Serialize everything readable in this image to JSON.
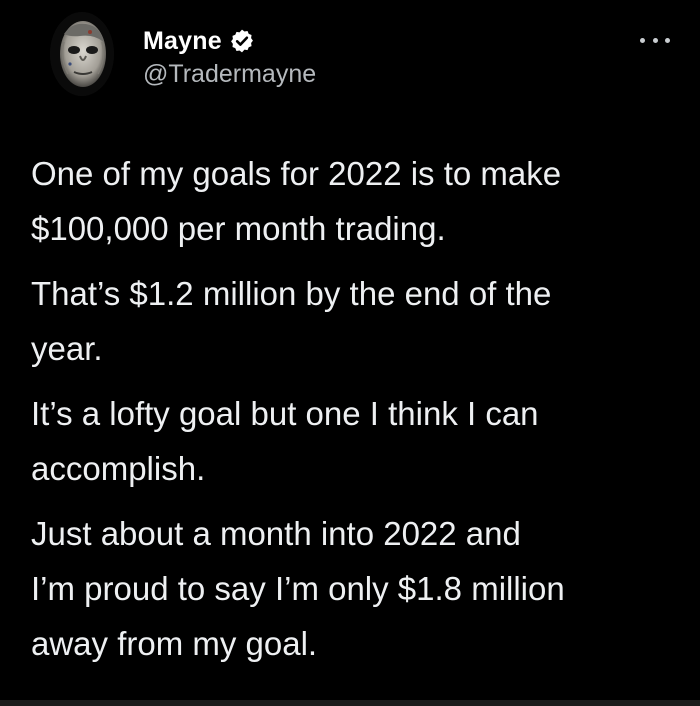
{
  "tweet": {
    "author": {
      "display_name": "Mayne",
      "handle": "@Tradermayne",
      "verified": true,
      "avatar": "masked-face-avatar"
    },
    "more_icon": "more-options-icon",
    "paragraphs": [
      {
        "line1": "One of my goals for 2022 is to make",
        "line2": "$100,000 per month trading."
      },
      {
        "line1": "That’s $1.2 million by the end of the",
        "line2": "year."
      },
      {
        "line1": "It’s a lofty goal but one I think I can",
        "line2": "accomplish."
      },
      {
        "line1": "Just about a month into 2022 and",
        "line2": "I’m proud to say I’m only $1.8 million",
        "line3": "away from my goal."
      }
    ]
  },
  "colors": {
    "background": "#000000",
    "text": "#eef0f2",
    "handle": "#b5b9bd",
    "verified_badge": "#ffffff"
  }
}
